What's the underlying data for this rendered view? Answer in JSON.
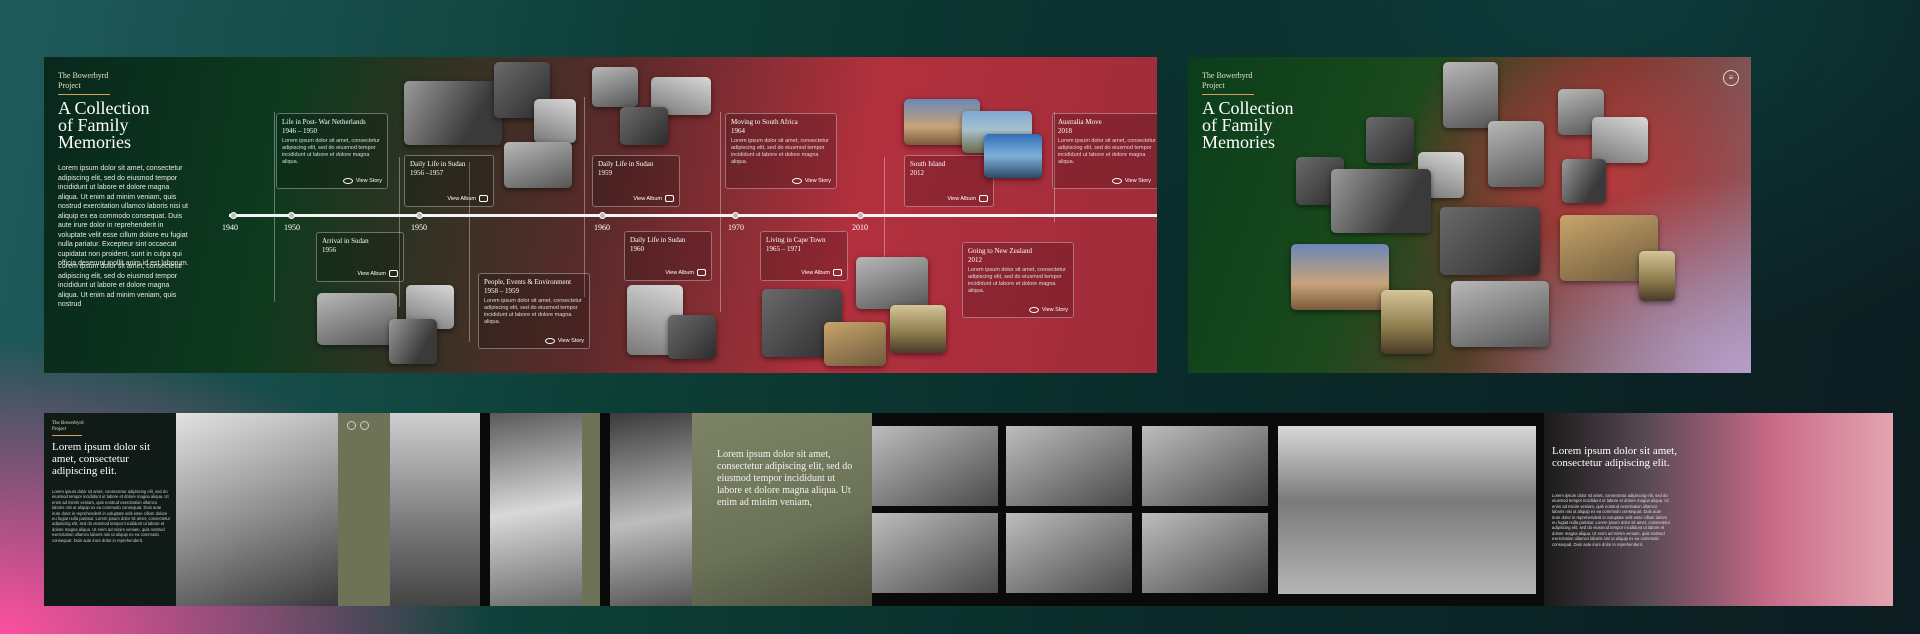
{
  "brand": "The Bowerbyrd Project",
  "brand_lines": [
    "The Bowerbyrd",
    "Project"
  ],
  "title_lines": [
    "A Collection",
    "of Family",
    "Memories"
  ],
  "intro_p1": "Lorem ipsum dolor sit amet, consectetur adipiscing elit, sed do eiusmod tempor incididunt ut labore et dolore magna aliqua. Ut enim ad minim veniam, quis nostrud exercitation ullamco laboris nisi ut aliquip ex ea commodo consequat. Duis aute irure dolor in reprehenderit in voluptate velit esse cillum dolore eu fugiat nulla pariatur. Excepteur sint occaecat cupidatat non proident, sunt in culpa qui officia deserunt mollit anim id est laborum.",
  "intro_p2": "Lorem ipsum dolor sit amet, consectetur adipiscing elit, sed do eiusmod tempor incididunt ut labore et dolore magna aliqua. Ut enim ad minim veniam, quis nostrud",
  "card_text": "Lorem ipsum dolor sit amet, consectetur adipiscing elit, sed do eiusmod tempor incididunt ut labore et dolore magna aliqua.",
  "years": [
    "1940",
    "1950",
    "1950",
    "1960",
    "1970",
    "2010"
  ],
  "events": [
    {
      "title": "Life in Post- War Netherlands",
      "dates": "1946 – 1950",
      "link": "View Story"
    },
    {
      "title": "Daily Life in Sudan",
      "dates": "1956 –1957",
      "link": "View Album"
    },
    {
      "title": "Arrival in Sudan",
      "dates": "1956",
      "link": "View Album"
    },
    {
      "title": "People, Events & Environment",
      "dates": "1958 – 1959",
      "link": "View Story"
    },
    {
      "title": "Daily Life in Sudan",
      "dates": "1959",
      "link": "View Album"
    },
    {
      "title": "Daily Life in Sudan",
      "dates": "1960",
      "link": "View Album"
    },
    {
      "title": "Moving to South Africa",
      "dates": "1964",
      "link": "View Story"
    },
    {
      "title": "Living in Cape Town",
      "dates": "1965 – 1971",
      "link": "View Album"
    },
    {
      "title": "South Island",
      "dates": "2012",
      "link": "View Album"
    },
    {
      "title": "Going to New Zealand",
      "dates": "2012",
      "link": "View Story"
    },
    {
      "title": "Australia Move",
      "dates": "2018",
      "link": "View Story"
    }
  ],
  "strip": {
    "heading": "Lorem ipsum dolor sit amet, consectetur adipiscing elit.",
    "body": "Lorem ipsum dolor sit amet, consectetur adipiscing elit, sed do eiusmod tempor incididunt ut labore et dolore magna aliqua. Ut enim ad minim veniam, quis nostrud exercitation ullamco laboris nisi ut aliquip ex ea commodo consequat. Duis aute irure dolor in reprehenderit in voluptate velit esse cillum dolore eu fugiat nulla pariatur. Lorem ipsum dolor sit amet, consectetur adipiscing elit, sed do eiusmod tempor incididunt ut labore et dolore magna aliqua. Ut enim ad minim veniam, quis nostrud exercitation ullamco laboris nisi ut aliquip ex ea commodo consequat. Duis aute irure dolor in reprehenderit.",
    "quote": "Lorem ipsum dolor sit amet, consectetur adipiscing elit, sed do eiusmod tempor incididunt ut labore et dolore magna aliqua. Ut enim ad minim veniam,",
    "heading2": "Lorem ipsum dolor sit amet, consectetur adipiscing elit."
  },
  "icons": {
    "menu": "menu-icon",
    "eye": "eye-icon",
    "album": "gallery-icon"
  },
  "colors": {
    "accent_line": "#d6a05a",
    "panel_red": "#b3303e",
    "panel_green": "#0e3a1e",
    "sage": "#7d8466"
  }
}
